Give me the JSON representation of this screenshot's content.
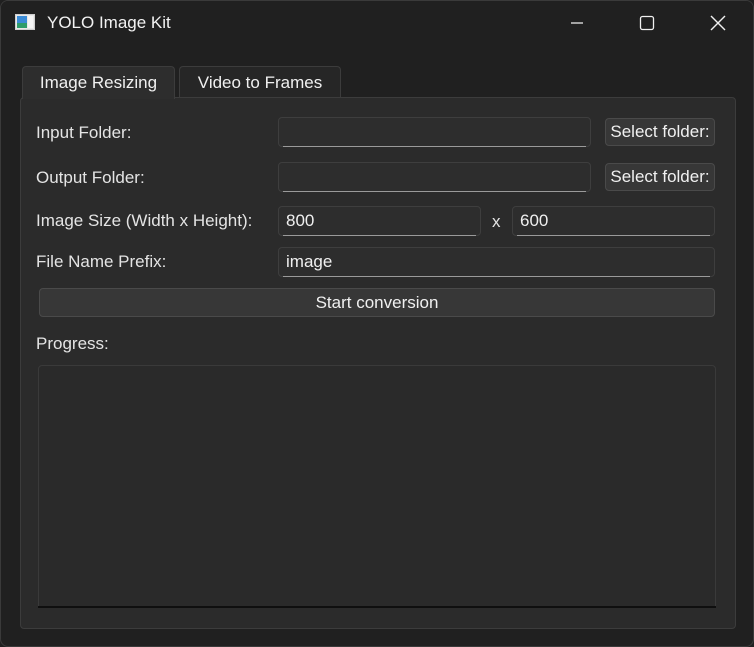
{
  "window": {
    "title": "YOLO Image Kit",
    "icons": {
      "app": "app-icon",
      "minimize": "minimize-icon",
      "maximize": "maximize-icon",
      "close": "close-icon"
    }
  },
  "tabs": [
    {
      "label": "Image Resizing",
      "active": true
    },
    {
      "label": "Video to Frames",
      "active": false
    }
  ],
  "form": {
    "input_folder": {
      "label": "Input Folder:",
      "value": "",
      "button": "Select folder:"
    },
    "output_folder": {
      "label": "Output Folder:",
      "value": "",
      "button": "Select folder:"
    },
    "image_size": {
      "label": "Image Size (Width x Height):",
      "width": "800",
      "separator": "x",
      "height": "600"
    },
    "prefix": {
      "label": "File Name Prefix:",
      "value": "image"
    },
    "start_button": "Start conversion",
    "progress_label": "Progress:",
    "progress_log": ""
  },
  "colors": {
    "background": "#202020",
    "panel": "#2b2b2b",
    "button": "#373737",
    "text": "#e8e8e8"
  }
}
